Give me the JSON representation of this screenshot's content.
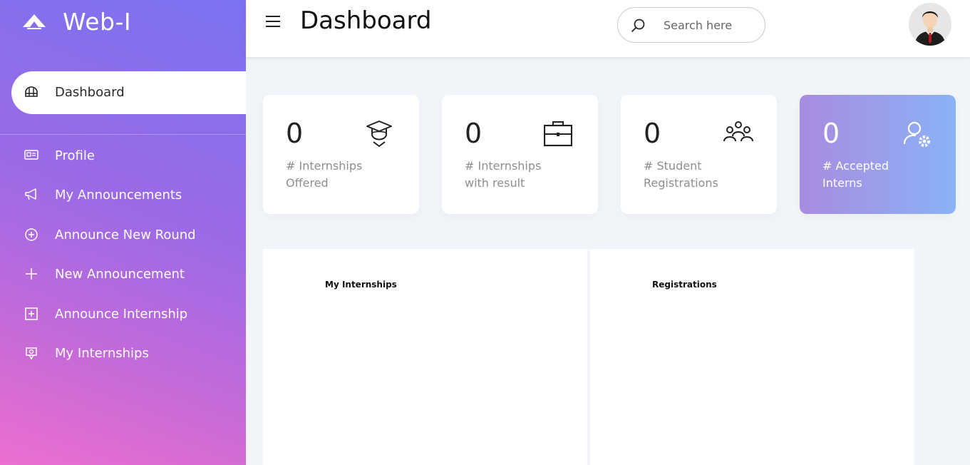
{
  "brand": {
    "name": "Web-I"
  },
  "sidebar": {
    "active": {
      "label": "Dashboard"
    },
    "items": [
      {
        "label": "Profile"
      },
      {
        "label": "My Announcements"
      },
      {
        "label": "Announce New Round"
      },
      {
        "label": "New Announcement"
      },
      {
        "label": "Announce Internship"
      },
      {
        "label": "My Internships"
      }
    ]
  },
  "header": {
    "title": "Dashboard",
    "search_placeholder": "Search here"
  },
  "cards": [
    {
      "count": "0",
      "label": "# Internships Offered",
      "icon": "graduate-icon"
    },
    {
      "count": "0",
      "label": "# Internships with result",
      "icon": "briefcase-icon"
    },
    {
      "count": "0",
      "label": "# Student Registrations",
      "icon": "group-icon"
    },
    {
      "count": "0",
      "label": "# Accepted Interns",
      "icon": "user-gear-icon"
    }
  ],
  "panels": [
    {
      "title": "My Internships"
    },
    {
      "title": "Registrations"
    }
  ],
  "colors": {
    "sidebar_top": "#7a72f0",
    "sidebar_bottom": "#ec6fcf",
    "accent_card_start": "#a98be0",
    "accent_card_end": "#8ab2f6"
  }
}
